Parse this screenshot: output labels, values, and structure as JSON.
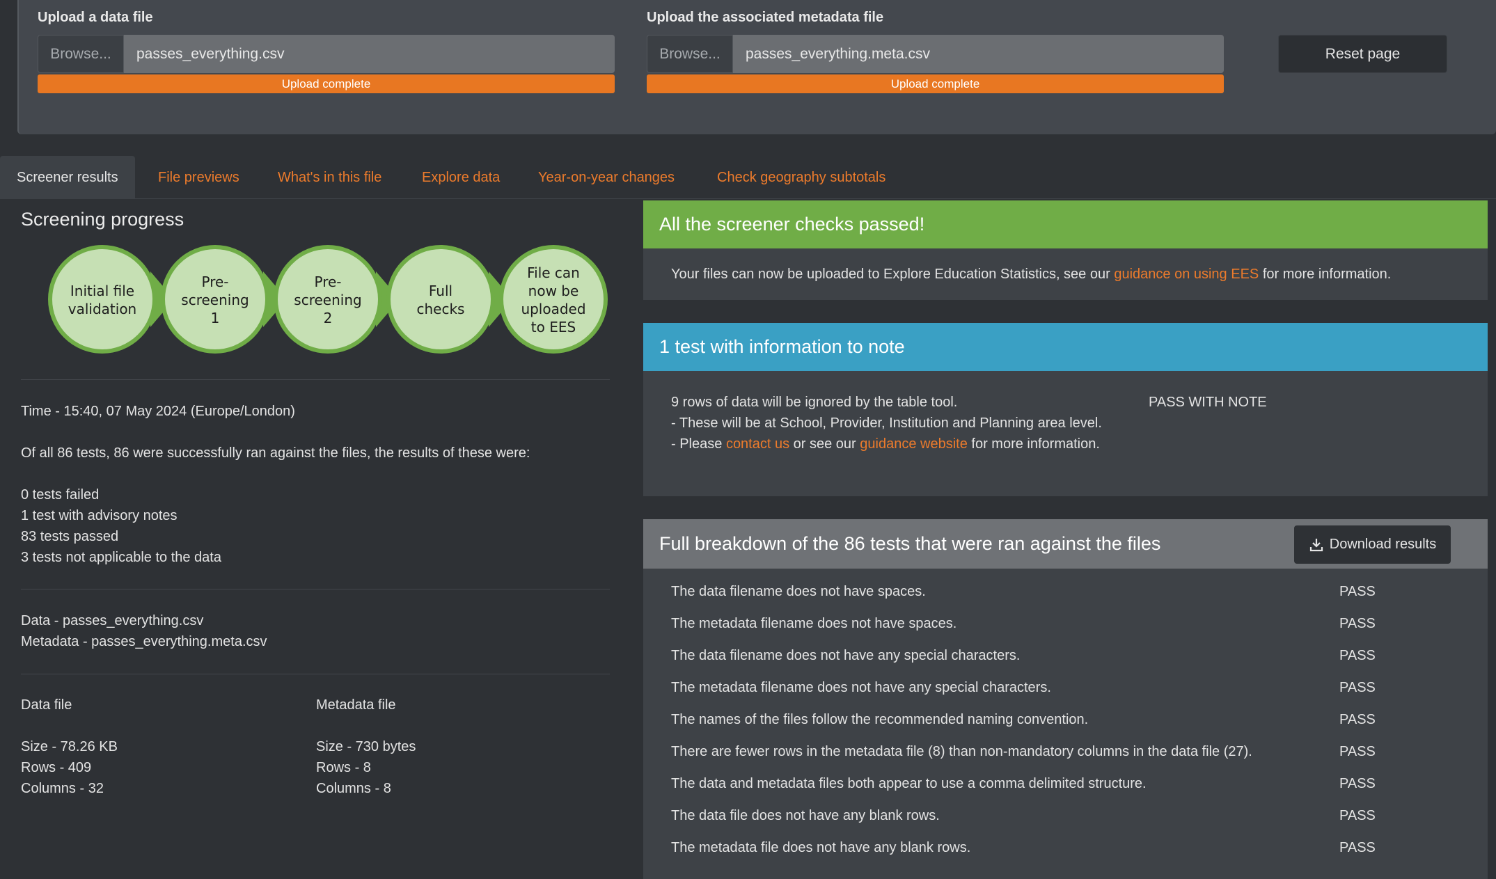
{
  "upload": {
    "data": {
      "label": "Upload a data file",
      "browse": "Browse...",
      "filename": "passes_everything.csv",
      "status": "Upload complete",
      "progress_percent": 100
    },
    "meta": {
      "label": "Upload the associated metadata file",
      "browse": "Browse...",
      "filename": "passes_everything.meta.csv",
      "status": "Upload complete",
      "progress_percent": 100
    },
    "reset": "Reset page"
  },
  "tabs": [
    "Screener results",
    "File previews",
    "What's in this file",
    "Explore data",
    "Year-on-year changes",
    "Check geography subtotals"
  ],
  "progress": {
    "title": "Screening progress",
    "steps": [
      [
        "Initial file",
        "validation"
      ],
      [
        "Pre-",
        "screening",
        "1"
      ],
      [
        "Pre-",
        "screening",
        "2"
      ],
      [
        "Full",
        "checks"
      ],
      [
        "File can",
        "now be",
        "uploaded",
        "to EES"
      ]
    ],
    "colors": {
      "circle_fill": "#c6e0b4",
      "border": "#70ad47",
      "arrow": "#70ad47"
    }
  },
  "summary": {
    "time": "Time - 15:40, 07 May 2024 (Europe/London)",
    "intro": "Of all 86 tests, 86 were successfully ran against the files, the results of these were:",
    "failed": "0 tests failed",
    "advisory": "1 test with advisory notes",
    "passed": "83 tests passed",
    "na": "3 tests not applicable to the data",
    "data_file": "Data - passes_everything.csv",
    "meta_file": "Metadata - passes_everything.meta.csv"
  },
  "file_details": {
    "data": {
      "heading": "Data file",
      "size": "Size - 78.26 KB",
      "rows": "Rows - 409",
      "columns": "Columns - 32"
    },
    "meta": {
      "heading": "Metadata file",
      "size": "Size - 730 bytes",
      "rows": "Rows - 8",
      "columns": "Columns - 8"
    }
  },
  "passed_card": {
    "title": "All the screener checks passed!",
    "text_before": "Your files can now be uploaded to Explore Education Statistics, see our ",
    "link": "guidance on using EES",
    "text_after": " for more information."
  },
  "note_card": {
    "title": "1 test with information to note",
    "line1": "9 rows of data will be ignored by the table tool.",
    "line2": "- These will be at School, Provider, Institution and Planning area level.",
    "line3_before": "- Please ",
    "link1": "contact us",
    "line3_middle": " or see our ",
    "link2": "guidance website",
    "line3_after": " for more information.",
    "status": "PASS WITH NOTE"
  },
  "breakdown": {
    "title": "Full breakdown of the 86 tests that were ran against the files",
    "download": "Download results",
    "tests": [
      {
        "name": "The data filename does not have spaces.",
        "result": "PASS"
      },
      {
        "name": "The metadata filename does not have spaces.",
        "result": "PASS"
      },
      {
        "name": "The data filename does not have any special characters.",
        "result": "PASS"
      },
      {
        "name": "The metadata filename does not have any special characters.",
        "result": "PASS"
      },
      {
        "name": "The names of the files follow the recommended naming convention.",
        "result": "PASS"
      },
      {
        "name": "There are fewer rows in the metadata file (8) than non-mandatory columns in the data file (27).",
        "result": "PASS"
      },
      {
        "name": "The data and metadata files both appear to use a comma delimited structure.",
        "result": "PASS"
      },
      {
        "name": "The data file does not have any blank rows.",
        "result": "PASS"
      },
      {
        "name": "The metadata file does not have any blank rows.",
        "result": "PASS"
      }
    ]
  }
}
